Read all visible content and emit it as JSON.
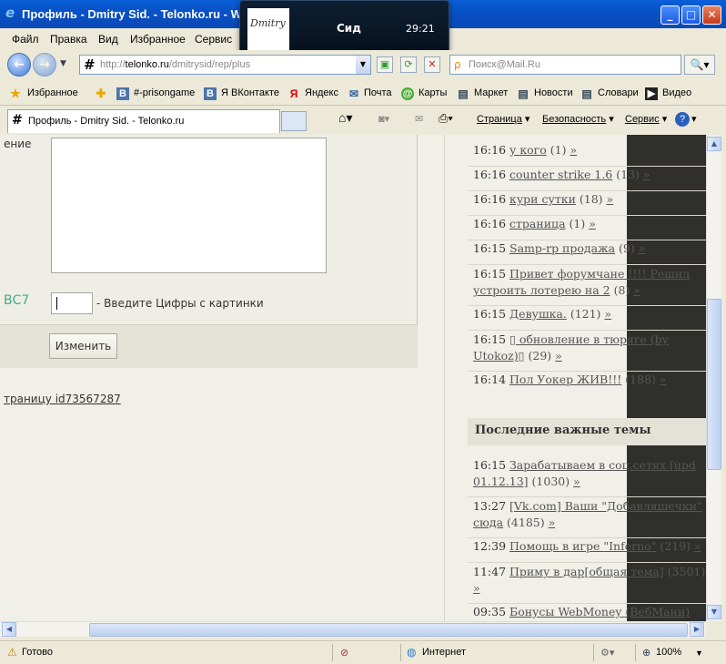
{
  "window": {
    "title": "Профиль - Dmitry Sid. - Telonko.ru - W"
  },
  "popup": {
    "name": "Сид",
    "time": "29:21",
    "thumb_text": "Dmitry"
  },
  "menu": [
    "Файл",
    "Правка",
    "Вид",
    "Избранное",
    "Сервис"
  ],
  "address": {
    "prefix": "http://",
    "host": "telonko.ru",
    "path": "/dmitrysid/rep/plus"
  },
  "search": {
    "placeholder": "Поиск@Mail.Ru"
  },
  "favorites": {
    "label": "Избранное",
    "items": [
      "#-prisongame",
      "Я ВКонтакте",
      "Яндекс",
      "Почта",
      "Карты",
      "Маркет",
      "Новости",
      "Словари",
      "Видео"
    ]
  },
  "tab": {
    "title": "Профиль - Dmitry Sid. - Telonko.ru"
  },
  "commands": [
    "Страница",
    "Безопасность",
    "Сервис"
  ],
  "form": {
    "field_label": "ение",
    "captcha_prefix": "ВС7",
    "captcha_hint": "- Введите Цифры с картинки",
    "submit": "Изменить",
    "link": "траницу id73567287"
  },
  "recent": [
    {
      "time": "16:16",
      "title": "у кого",
      "count": "(1)"
    },
    {
      "time": "16:16",
      "title": "counter strike 1.6",
      "count": "(13)"
    },
    {
      "time": "16:16",
      "title": "кури сутки",
      "count": "(18)"
    },
    {
      "time": "16:16",
      "title": "страница",
      "count": "(1)"
    },
    {
      "time": "16:15",
      "title": "Samp-rp продажа",
      "count": "(9)"
    },
    {
      "time": "16:15",
      "title": "Привет форумчане !!!! Решил устроить лотерею на 2",
      "count": "(8)"
    },
    {
      "time": "16:15",
      "title": "Девушка.",
      "count": "(121)"
    },
    {
      "time": "16:15",
      "title": "▯ обновление в тюряге (by Utokoz)▯",
      "count": "(29)"
    },
    {
      "time": "16:14",
      "title": "Пол Уокер ЖИВ!!!",
      "count": "(188)"
    }
  ],
  "important": {
    "heading": "Последние важные темы",
    "items": [
      {
        "time": "16:15",
        "title": "Зарабатываем в соц.сетях [upd 01.12.13]",
        "count": "(1030)"
      },
      {
        "time": "13:27",
        "title": "[Vk.com] Ваши \"Добавляшечки\" сюда",
        "count": "(4185)"
      },
      {
        "time": "12:39",
        "title": "Помощь в игре \"Inferno\"",
        "count": "(219)"
      },
      {
        "time": "11:47",
        "title": "Приму в дар[общая тема]",
        "count": "(3501)"
      },
      {
        "time": "09:35",
        "title": "Бонусы WebMoney (ВебМани)",
        "count": ""
      }
    ]
  },
  "status": {
    "text": "Готово",
    "zone": "Интернет",
    "zoom": "100%"
  },
  "arrow": "»"
}
